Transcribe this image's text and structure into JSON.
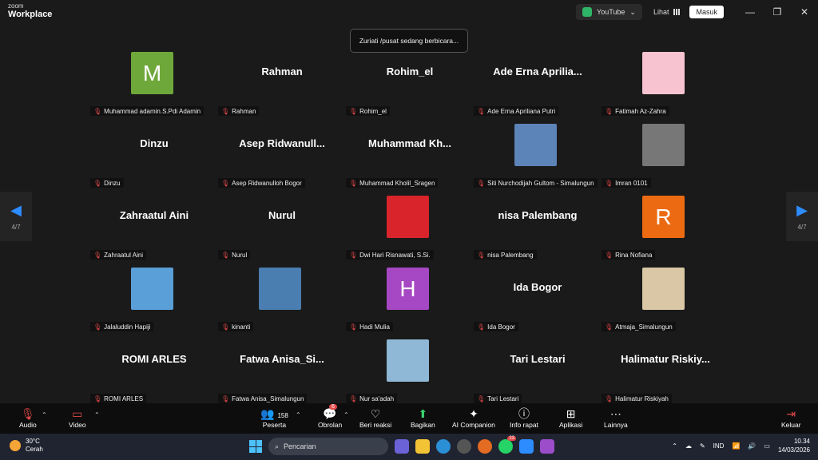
{
  "app": {
    "brand_small": "zoom",
    "brand_big": "Workplace"
  },
  "titlebar": {
    "youtube": "YouTube",
    "lihat": "Lihat",
    "masuk": "Masuk"
  },
  "speaker_notice": "Zuriati /pusat sedang berbicara...",
  "pager": {
    "left": "4/7",
    "right": "4/7"
  },
  "participants": [
    {
      "display": "M",
      "avatar_color": "#6fa83a",
      "label": "Muhammad adamin.S.Pdi Adamin"
    },
    {
      "display": "Rahman",
      "label": "Rahman"
    },
    {
      "display": "Rohim_el",
      "label": "Rohim_el"
    },
    {
      "display": "Ade Erna Aprilia...",
      "label": "Ade Erna Apriliana Putri"
    },
    {
      "display": "",
      "avatar_color": "#f7c3d0",
      "label": "Fatimah Az-Zahra"
    },
    {
      "display": "Dinzu",
      "label": "Dinzu"
    },
    {
      "display": "Asep Ridwanull...",
      "label": "Asep Ridwanulloh Bogor"
    },
    {
      "display": "Muhammad Kh...",
      "label": "Muhammad Kholil_Sragen"
    },
    {
      "display": "",
      "avatar_color": "#5d84b8",
      "label": "Siti Nurchodijah Gultom - Simalungun"
    },
    {
      "display": "",
      "avatar_color": "#777777",
      "label": "Imran 0101"
    },
    {
      "display": "Zahraatul Aini",
      "label": "Zahraatul Aini"
    },
    {
      "display": "Nurul",
      "label": "Nurul"
    },
    {
      "display": "",
      "avatar_color": "#d8242a",
      "label": "Dwi Hari Risnawati, S.Si."
    },
    {
      "display": "nisa Palembang",
      "label": "nisa Palembang"
    },
    {
      "display": "R",
      "avatar_color": "#ec6b12",
      "label": "Rina Nofiana"
    },
    {
      "display": "",
      "avatar_color": "#5a9fd8",
      "label": "Jalaluddin Hapiji"
    },
    {
      "display": "",
      "avatar_color": "#4a7db0",
      "label": "kinanti"
    },
    {
      "display": "H",
      "avatar_color": "#a648c3",
      "label": "Hadi Mulia"
    },
    {
      "display": "Ida Bogor",
      "label": "Ida Bogor"
    },
    {
      "display": "",
      "avatar_color": "#d9c7a6",
      "label": "Atmaja_Simalungun"
    },
    {
      "display": "ROMI ARLES",
      "label": "ROMI ARLES"
    },
    {
      "display": "Fatwa Anisa_Si...",
      "label": "Fatwa Anisa_Simalungun"
    },
    {
      "display": "",
      "avatar_color": "#8fb7d6",
      "label": "Nur sa'adah"
    },
    {
      "display": "Tari Lestari",
      "label": "Tari Lestari"
    },
    {
      "display": "Halimatur Riskiy...",
      "label": "Halimatur Riskiyah"
    }
  ],
  "controls": {
    "audio": "Audio",
    "video": "Video",
    "peserta": "Peserta",
    "peserta_count": "158",
    "obrolan": "Obrolan",
    "obrolan_badge": "6",
    "beri_reaksi": "Beri reaksi",
    "bagikan": "Bagikan",
    "ai_companion": "AI Companion",
    "info_rapat": "Info rapat",
    "aplikasi": "Aplikasi",
    "lainnya": "Lainnya",
    "keluar": "Keluar"
  },
  "taskbar": {
    "temp": "30°C",
    "weather": "Cerah",
    "search": "Pencarian",
    "whatsapp_badge": "23",
    "lang": "IND",
    "time": "10.34",
    "date": "14/03/2026"
  }
}
